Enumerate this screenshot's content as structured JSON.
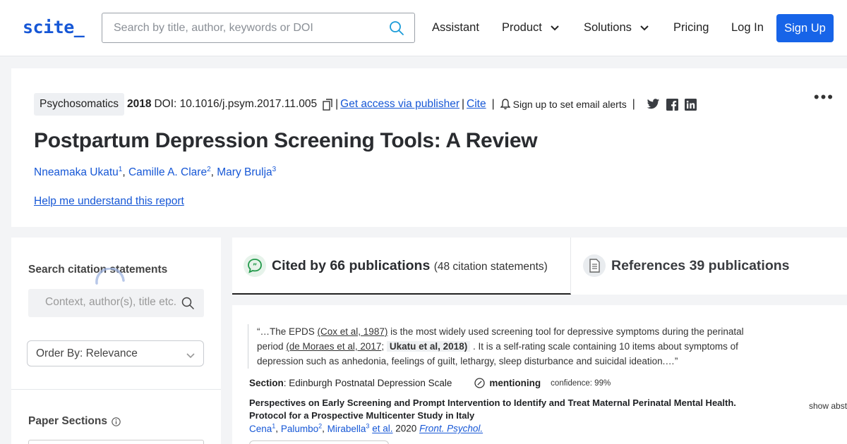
{
  "header": {
    "logo": "scite_",
    "search_placeholder": "Search by title, author, keywords or DOI",
    "nav": [
      {
        "label": "Assistant"
      },
      {
        "label": "Product"
      },
      {
        "label": "Solutions"
      },
      {
        "label": "Pricing"
      },
      {
        "label": "Log In"
      }
    ],
    "signup_label": "Sign Up",
    "accent": "#1764e8"
  },
  "paper": {
    "journal": "Psychosomatics",
    "year": "2018",
    "doi": "DOI: 10.1016/j.psym.2017.11.005",
    "access_link": "Get access via publisher",
    "cite_link": "Cite",
    "alerts_text": "Sign up to set email alerts",
    "title": "Postpartum Depression Screening Tools: A Review",
    "authors": [
      {
        "name": "Nneamaka Ukatu",
        "sup": "1"
      },
      {
        "name": "Camille A. Clare",
        "sup": "2"
      },
      {
        "name": "Mary Brulja",
        "sup": "3"
      }
    ],
    "help_link": "Help me understand this report"
  },
  "sidebar": {
    "search_heading": "Search citation statements",
    "context_placeholder": "Context, author(s), title etc.",
    "order_by": "Order By: Relevance",
    "paper_sections_heading": "Paper Sections"
  },
  "tabs": {
    "cited_by": "Cited by 66 publications",
    "cited_by_statements": "(48 citation statements)",
    "references": "References 39 publications"
  },
  "citation": {
    "quote_1": "“…The EPDS ",
    "ref_1": "(Cox et al, 1987)",
    "quote_2": " is the most widely used screening tool for depressive symptoms during the perinatal period ",
    "ref_2": "(de Moraes et al, 2017",
    "quote_3": "; ",
    "ref_self": "Ukatu et al, 2018)",
    "quote_4": " . It is a self-rating scale containing 10 items about symptoms of depression such as anhedonia, feelings of guilt, lethargy, sleep disturbance and suicidal ideation.…”",
    "section_label": "Section",
    "section_value": ": Edinburgh Postnatal Depression Scale",
    "classification": "mentioning",
    "confidence": "confidence: 99%",
    "source_title": "Perspectives on Early Screening and Prompt Intervention to Identify and Treat Maternal Perinatal Mental Health. Protocol for a Prospective Multicenter Study in Italy",
    "source_authors": [
      {
        "name": "Cena",
        "sup": "1"
      },
      {
        "name": "Palumbo",
        "sup": "2"
      },
      {
        "name": "Mirabella",
        "sup": "3"
      }
    ],
    "et_al": "et al.",
    "source_year": "2020",
    "source_journal": "Front. Psychol.",
    "show_abstract": "show abst"
  }
}
